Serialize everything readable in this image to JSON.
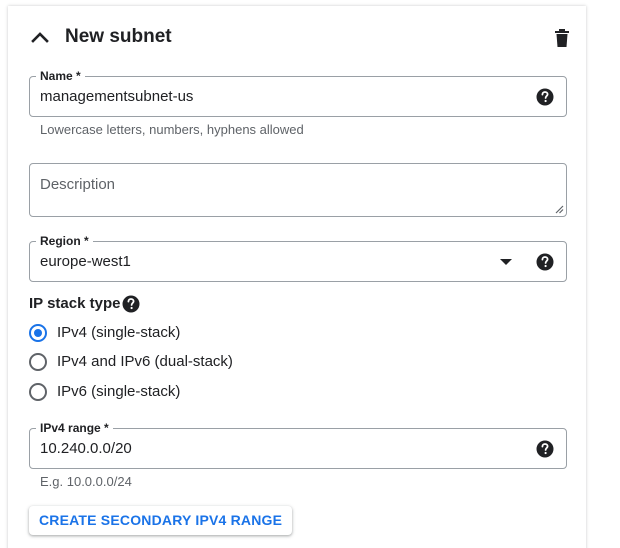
{
  "header": {
    "title": "New subnet"
  },
  "name_field": {
    "label": "Name *",
    "value": "managementsubnet-us",
    "hint": "Lowercase letters, numbers, hyphens allowed"
  },
  "description_field": {
    "placeholder": "Description"
  },
  "region_field": {
    "label": "Region *",
    "value": "europe-west1"
  },
  "ip_stack": {
    "label": "IP stack type",
    "options": [
      {
        "label": "IPv4 (single-stack)",
        "selected": true
      },
      {
        "label": "IPv4 and IPv6 (dual-stack)",
        "selected": false
      },
      {
        "label": "IPv6 (single-stack)",
        "selected": false
      }
    ]
  },
  "ipv4_range_field": {
    "label": "IPv4 range *",
    "value": "10.240.0.0/20",
    "hint": "E.g. 10.0.0.0/24"
  },
  "actions": {
    "secondary_range_label": "CREATE SECONDARY IPV4 RANGE"
  },
  "colors": {
    "accent": "#1a73e8",
    "text": "#202124",
    "muted": "#5f6368",
    "border": "#9aa0a6"
  },
  "icons": {
    "collapse": "chevron-up-icon",
    "delete": "trash-icon",
    "help": "help-circle-icon",
    "dropdown": "caret-down-icon"
  }
}
